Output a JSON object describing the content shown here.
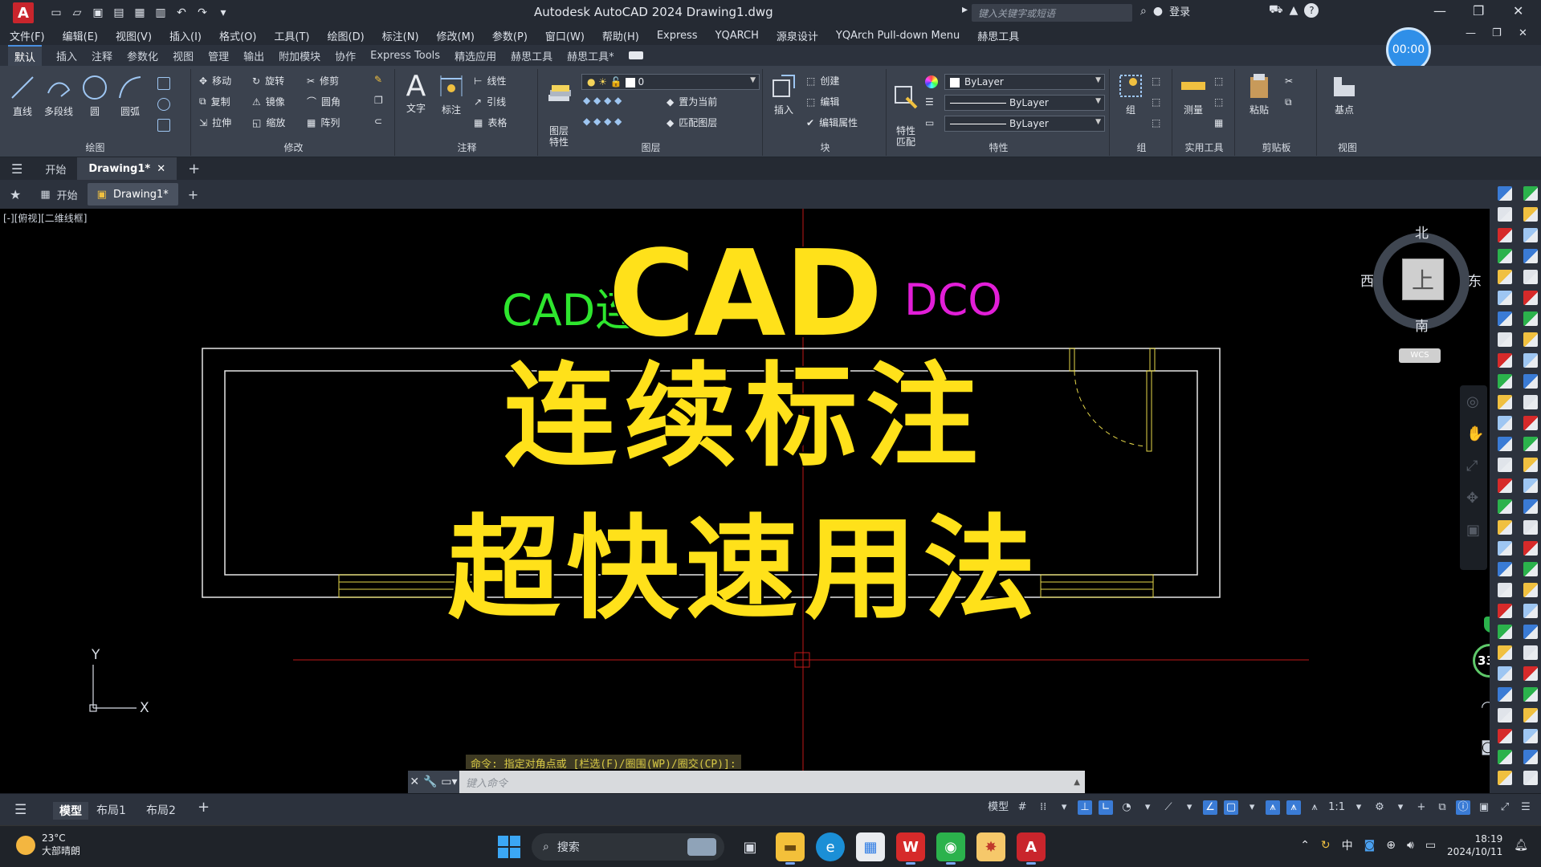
{
  "titlebar": {
    "app_logo": "A",
    "title": "Autodesk AutoCAD 2024    Drawing1.dwg",
    "search_placeholder": "键入关键字或短语",
    "login": "登录",
    "help": "?",
    "qat_icons": [
      "new-icon",
      "open-icon",
      "save-icon",
      "saveas-icon",
      "plot-icon",
      "undo-icon",
      "redo-icon"
    ]
  },
  "menubar": {
    "items": [
      "文件(F)",
      "编辑(E)",
      "视图(V)",
      "插入(I)",
      "格式(O)",
      "工具(T)",
      "绘图(D)",
      "标注(N)",
      "修改(M)",
      "参数(P)",
      "窗口(W)",
      "帮助(H)",
      "Express",
      "YQARCH",
      "源泉设计",
      "YQArch Pull-down Menu",
      "赫思工具"
    ]
  },
  "ribbon_tabs": {
    "items": [
      "默认",
      "插入",
      "注释",
      "参数化",
      "视图",
      "管理",
      "输出",
      "附加模块",
      "协作",
      "Express Tools",
      "精选应用",
      "赫思工具",
      "赫思工具*"
    ],
    "active_index": 0
  },
  "timer": "00:00",
  "ribbon": {
    "draw": {
      "label": "绘图",
      "line": "直线",
      "polyline": "多段线",
      "circle": "圆",
      "arc": "圆弧"
    },
    "modify": {
      "label": "修改",
      "move": "移动",
      "rotate": "旋转",
      "trim": "修剪",
      "copy": "复制",
      "mirror": "镜像",
      "fillet": "圆角",
      "stretch": "拉伸",
      "scale": "缩放",
      "array": "阵列"
    },
    "annotation": {
      "label": "注释",
      "text": "文字",
      "dimension": "标注",
      "linear": "线性",
      "leader": "引线",
      "table": "表格"
    },
    "layers": {
      "label": "图层",
      "props": "图层\n特性",
      "current_layer": "0",
      "set_current": "置为当前",
      "match_layer": "匹配图层"
    },
    "block": {
      "label": "块",
      "insert": "插入",
      "create": "创建",
      "edit": "编辑",
      "edit_attr": "编辑属性"
    },
    "properties": {
      "label": "特性",
      "match": "特性\n匹配",
      "color": "ByLayer",
      "linetype": "ByLayer",
      "lineweight": "ByLayer"
    },
    "groups": {
      "label": "组",
      "group": "组"
    },
    "utilities": {
      "label": "实用工具",
      "measure": "测量"
    },
    "clipboard": {
      "label": "剪贴板",
      "paste": "粘贴"
    },
    "view": {
      "label": "视图",
      "base": "基点"
    }
  },
  "file_tabs": {
    "start": "开始",
    "drawing": "Drawing1*"
  },
  "doc_tabs": {
    "start": "开始",
    "drawing": "Drawing1*"
  },
  "canvas": {
    "viewport_label": "[-][俯视][二维线框]",
    "green_text": "CAD连",
    "magenta_text": "DCO",
    "overlay_line1": "CAD",
    "overlay_line2": "连续标注",
    "overlay_line3": "超快速用法",
    "ucs_x": "X",
    "ucs_y": "Y"
  },
  "viewcube": {
    "north": "北",
    "south": "南",
    "east": "东",
    "west": "西",
    "face": "上",
    "wcs": "WCS"
  },
  "navbar": {
    "percent": "33"
  },
  "command": {
    "history": "命令: 指定对角点或 [栏选(F)/圈围(WP)/圈交(CP)]:",
    "placeholder": "键入命令"
  },
  "statusbar": {
    "tabs": [
      "模型",
      "布局1",
      "布局2"
    ],
    "active_index": 0,
    "model_label": "模型",
    "scale": "1:1"
  },
  "taskbar": {
    "temperature": "23°C",
    "weather": "大部晴朗",
    "search": "搜索",
    "ime": "中",
    "time": "18:19",
    "date": "2024/10/11"
  },
  "colors": {
    "accent": "#2f8fe8",
    "overlay_yellow": "#ffe11a",
    "green": "#2ee62e",
    "magenta": "#e21ed8",
    "autocad_red": "#c9252c"
  }
}
